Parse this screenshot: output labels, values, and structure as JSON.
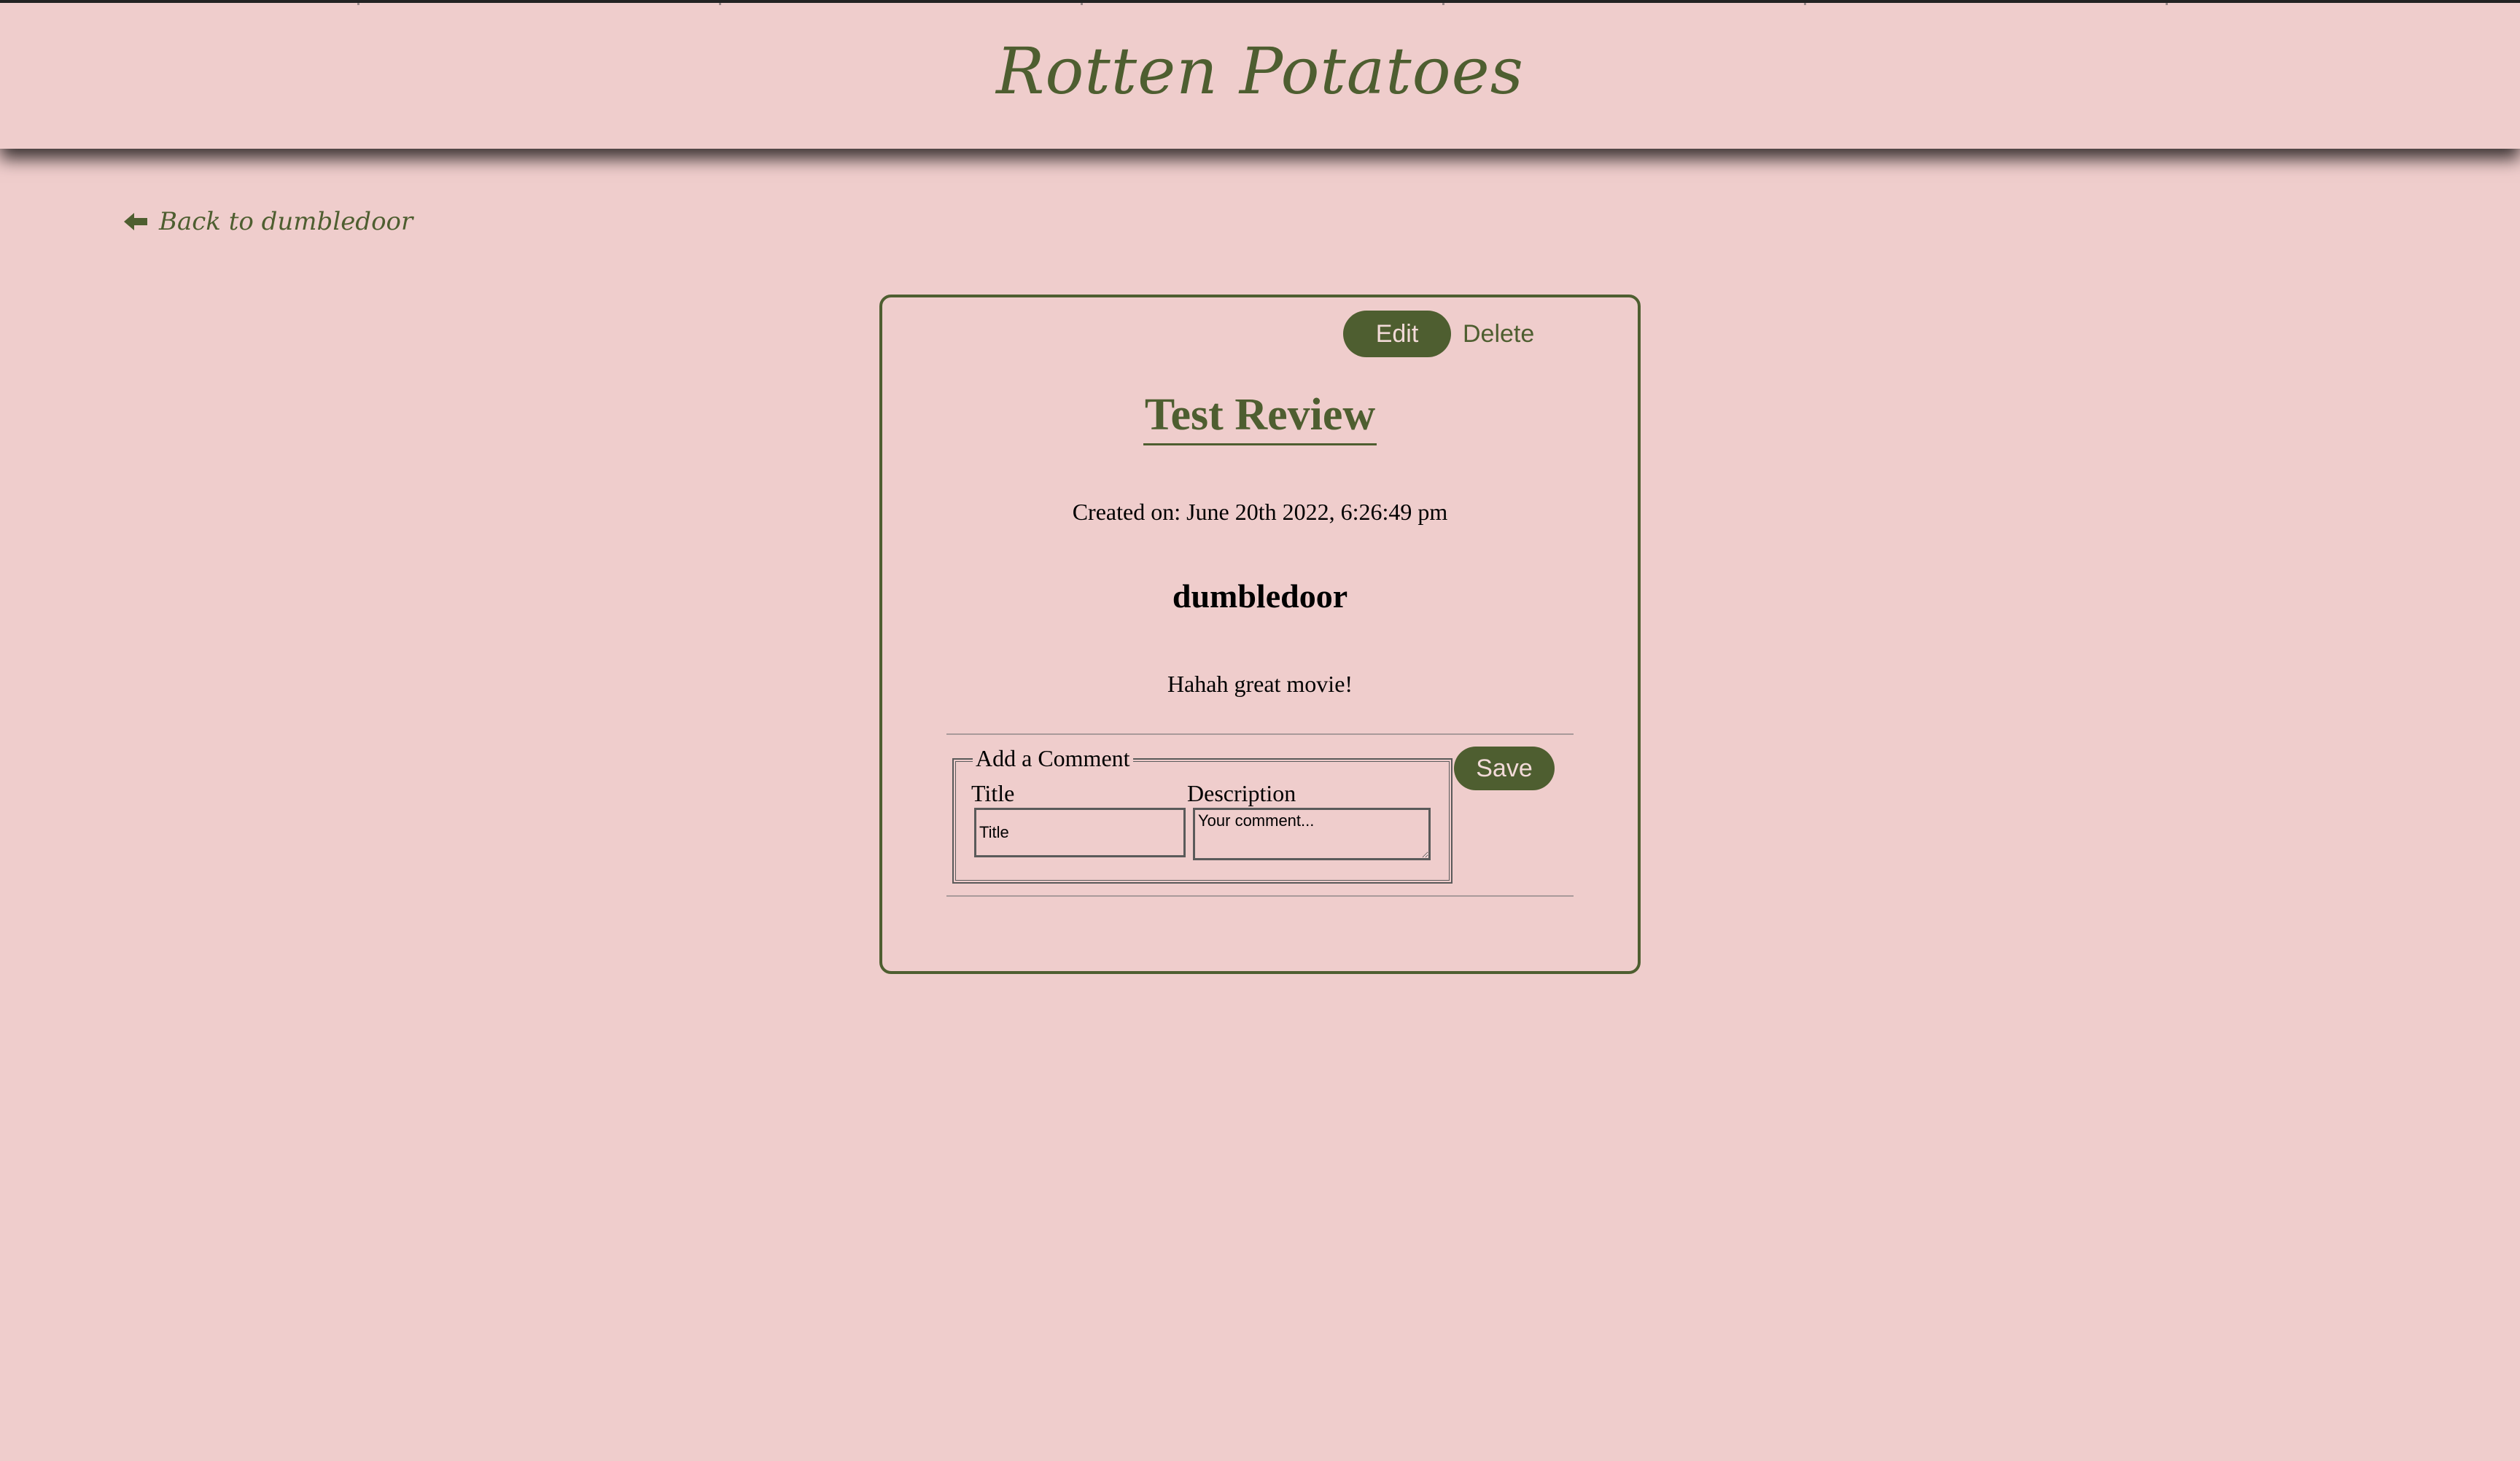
{
  "header": {
    "site_title": "Rotten Potatoes"
  },
  "nav": {
    "back_label": "Back to dumbledoor",
    "back_icon": "arrow-left-icon"
  },
  "review": {
    "edit_label": "Edit",
    "delete_label": "Delete",
    "title": "Test Review",
    "created": "Created on: June 20th 2022, 6:26:49 pm",
    "author": "dumbledoor",
    "body": "Hahah great movie!"
  },
  "comment_form": {
    "legend": "Add a Comment",
    "title_label": "Title",
    "title_placeholder": "Title",
    "title_value": "",
    "description_label": "Description",
    "description_placeholder": "Your comment...",
    "description_value": "",
    "save_label": "Save"
  },
  "colors": {
    "background": "#efcdcc",
    "accent": "#4e5e30",
    "button_text": "#f2dad8",
    "header_border": "#222222"
  }
}
